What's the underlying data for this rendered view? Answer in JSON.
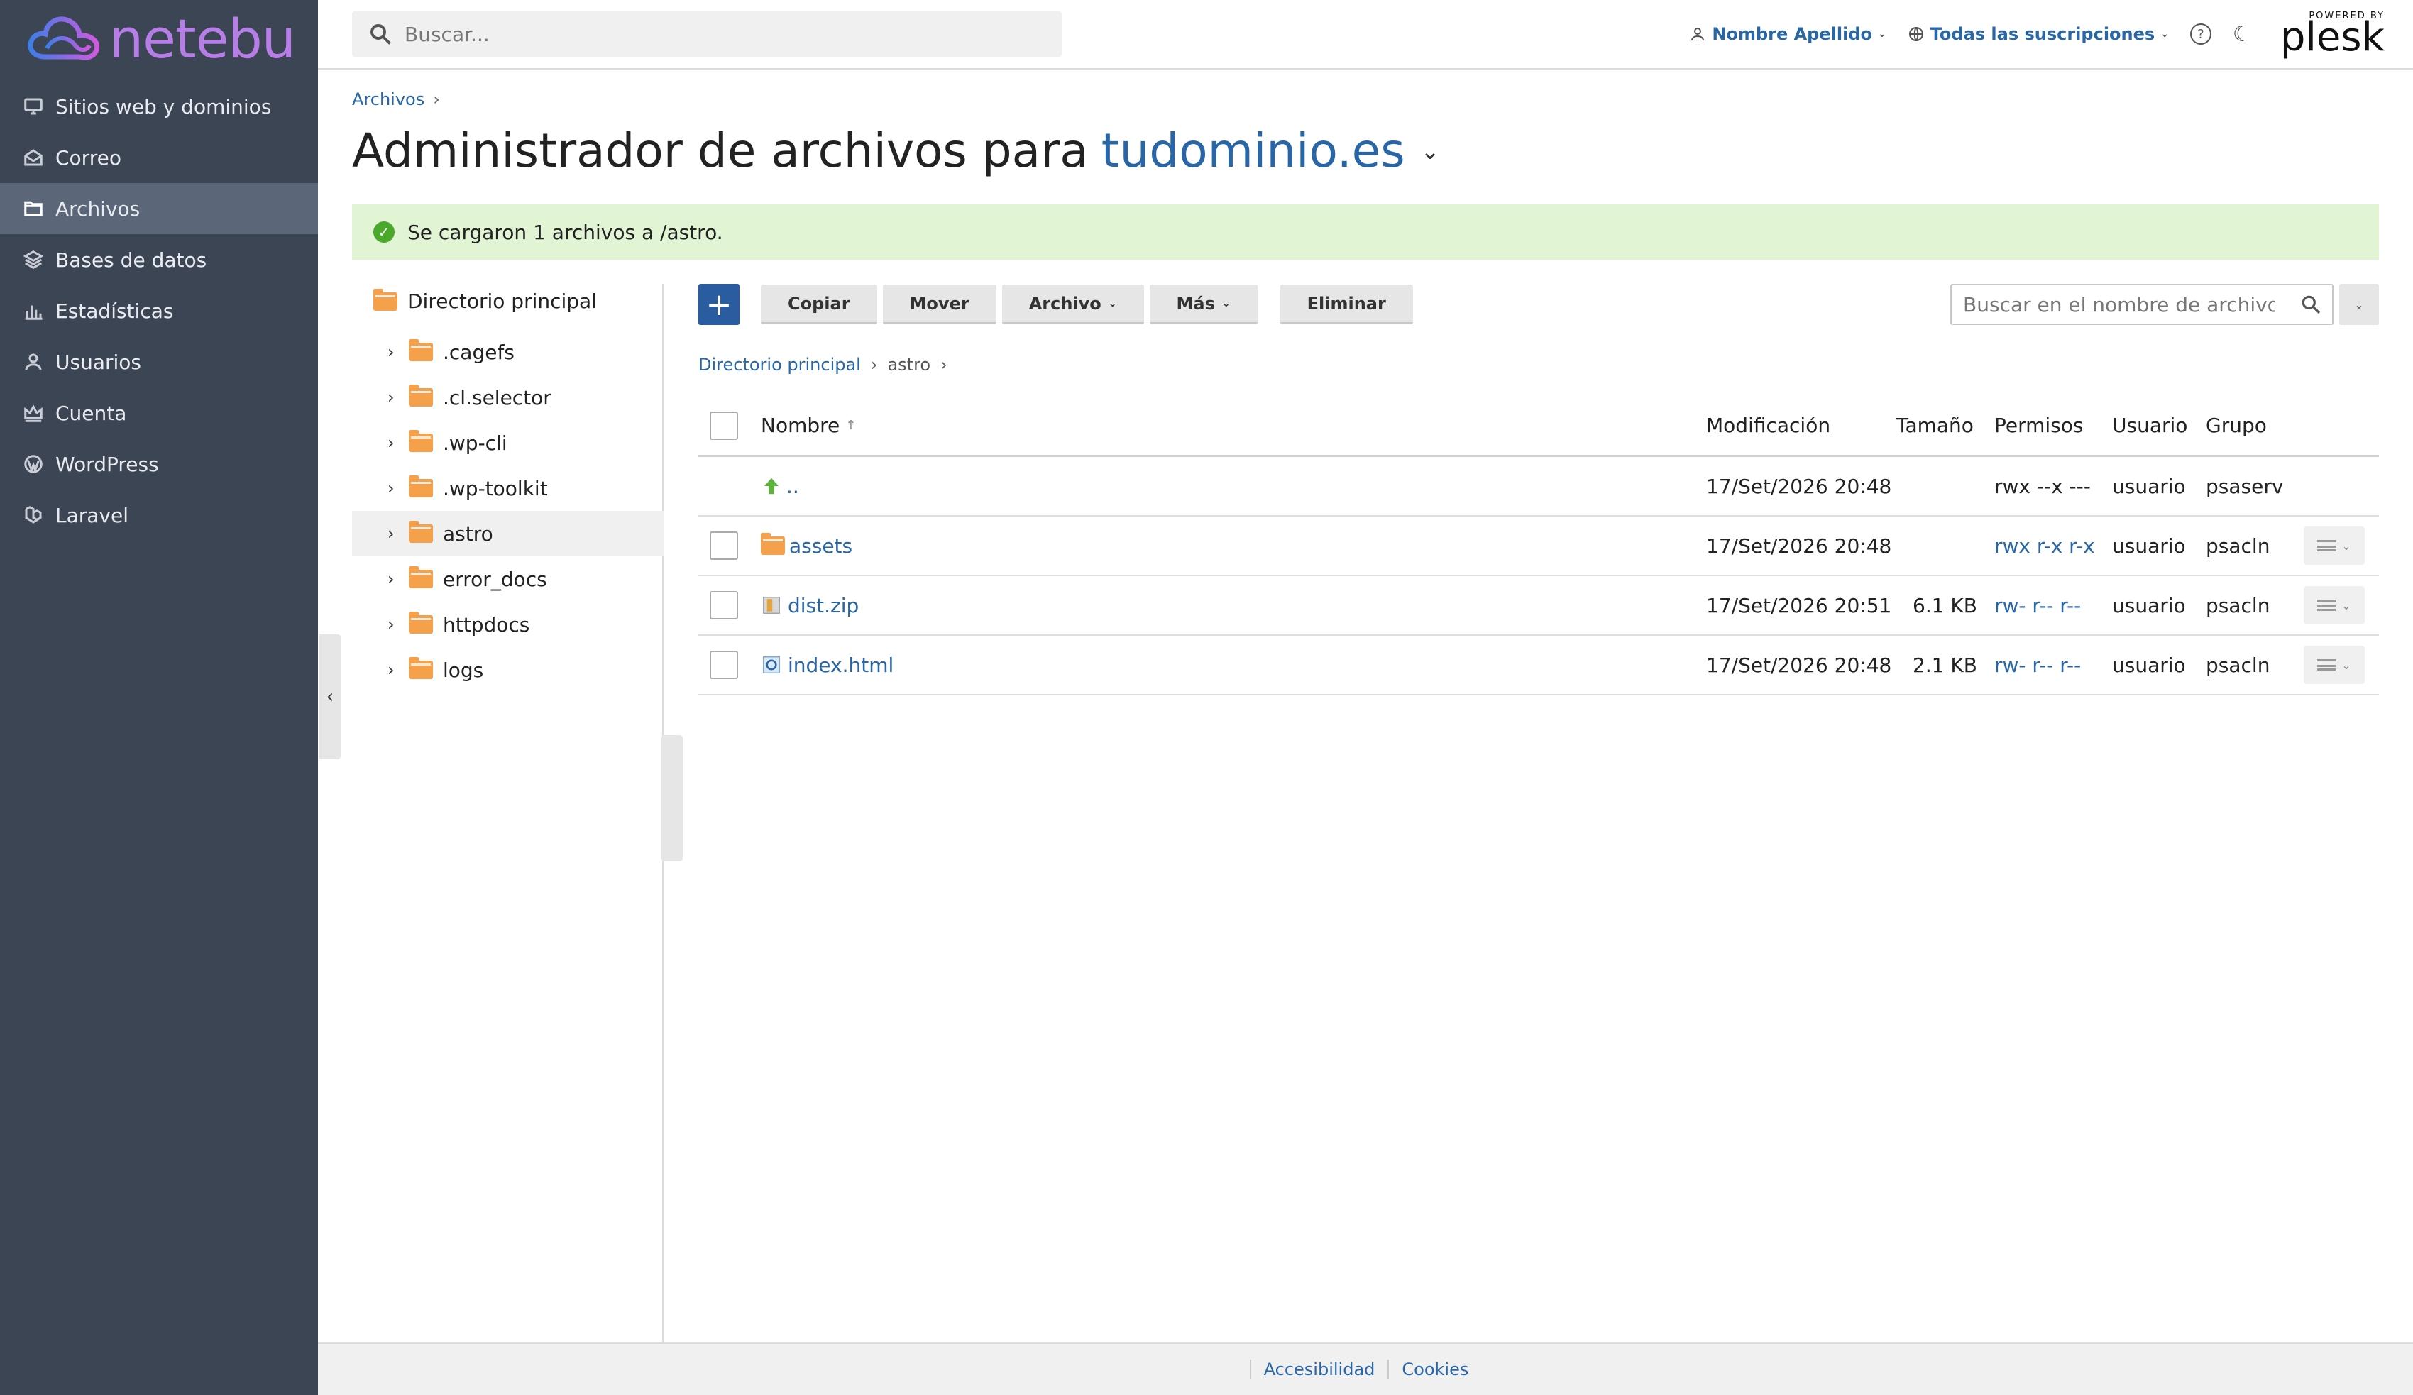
{
  "brand": {
    "name": "netebu"
  },
  "nav": {
    "items": [
      {
        "label": "Sitios web y dominios",
        "icon": "monitor-icon"
      },
      {
        "label": "Correo",
        "icon": "envelope-icon"
      },
      {
        "label": "Archivos",
        "icon": "folder-icon",
        "active": true
      },
      {
        "label": "Bases de datos",
        "icon": "layers-icon"
      },
      {
        "label": "Estadísticas",
        "icon": "bar-chart-icon"
      },
      {
        "label": "Usuarios",
        "icon": "user-icon"
      },
      {
        "label": "Cuenta",
        "icon": "crown-icon"
      },
      {
        "label": "WordPress",
        "icon": "wordpress-icon"
      },
      {
        "label": "Laravel",
        "icon": "laravel-icon"
      }
    ]
  },
  "topbar": {
    "search_placeholder": "Buscar...",
    "user_name": "Nombre Apellido",
    "subscriptions": "Todas las suscripciones",
    "powered_by": "POWERED BY",
    "plesk": "plesk"
  },
  "breadcrumb": {
    "root": "Archivos"
  },
  "title": {
    "prefix": "Administrador de archivos para",
    "domain": "tudominio.es"
  },
  "alert": {
    "message": "Se cargaron 1 archivos a /astro."
  },
  "tree": {
    "root": "Directorio principal",
    "items": [
      ".cagefs",
      ".cl.selector",
      ".wp-cli",
      ".wp-toolkit",
      "astro",
      "error_docs",
      "httpdocs",
      "logs"
    ],
    "selected": "astro"
  },
  "toolbar": {
    "add": "+",
    "copy": "Copiar",
    "move": "Mover",
    "file": "Archivo",
    "more": "Más",
    "delete": "Eliminar",
    "search_placeholder": "Buscar en el nombre de archivo"
  },
  "path": {
    "root": "Directorio principal",
    "current": "astro"
  },
  "table": {
    "headers": {
      "name": "Nombre",
      "sort": "↑",
      "modified": "Modificación",
      "size": "Tamaño",
      "perms": "Permisos",
      "user": "Usuario",
      "group": "Grupo"
    },
    "rows": [
      {
        "name": "..",
        "modified": "17/Set/2026 20:48",
        "size": "",
        "perms": "rwx --x ---",
        "user": "usuario",
        "group": "psaserv",
        "type": "parent"
      },
      {
        "name": "assets",
        "modified": "17/Set/2026 20:48",
        "size": "",
        "perms": "rwx r-x r-x",
        "user": "usuario",
        "group": "psacln",
        "type": "folder"
      },
      {
        "name": "dist.zip",
        "modified": "17/Set/2026 20:51",
        "size": "6.1 KB",
        "perms": "rw- r-- r--",
        "user": "usuario",
        "group": "psacln",
        "type": "zip"
      },
      {
        "name": "index.html",
        "modified": "17/Set/2026 20:48",
        "size": "2.1 KB",
        "perms": "rw- r-- r--",
        "user": "usuario",
        "group": "psacln",
        "type": "html"
      }
    ]
  },
  "footer": {
    "accessibility": "Accesibilidad",
    "cookies": "Cookies"
  },
  "colors": {
    "sidebar": "#3c4554",
    "active": "#5b6779",
    "link": "#2866a8",
    "alert": "#e1f4d4",
    "folder": "#f5a04a"
  }
}
